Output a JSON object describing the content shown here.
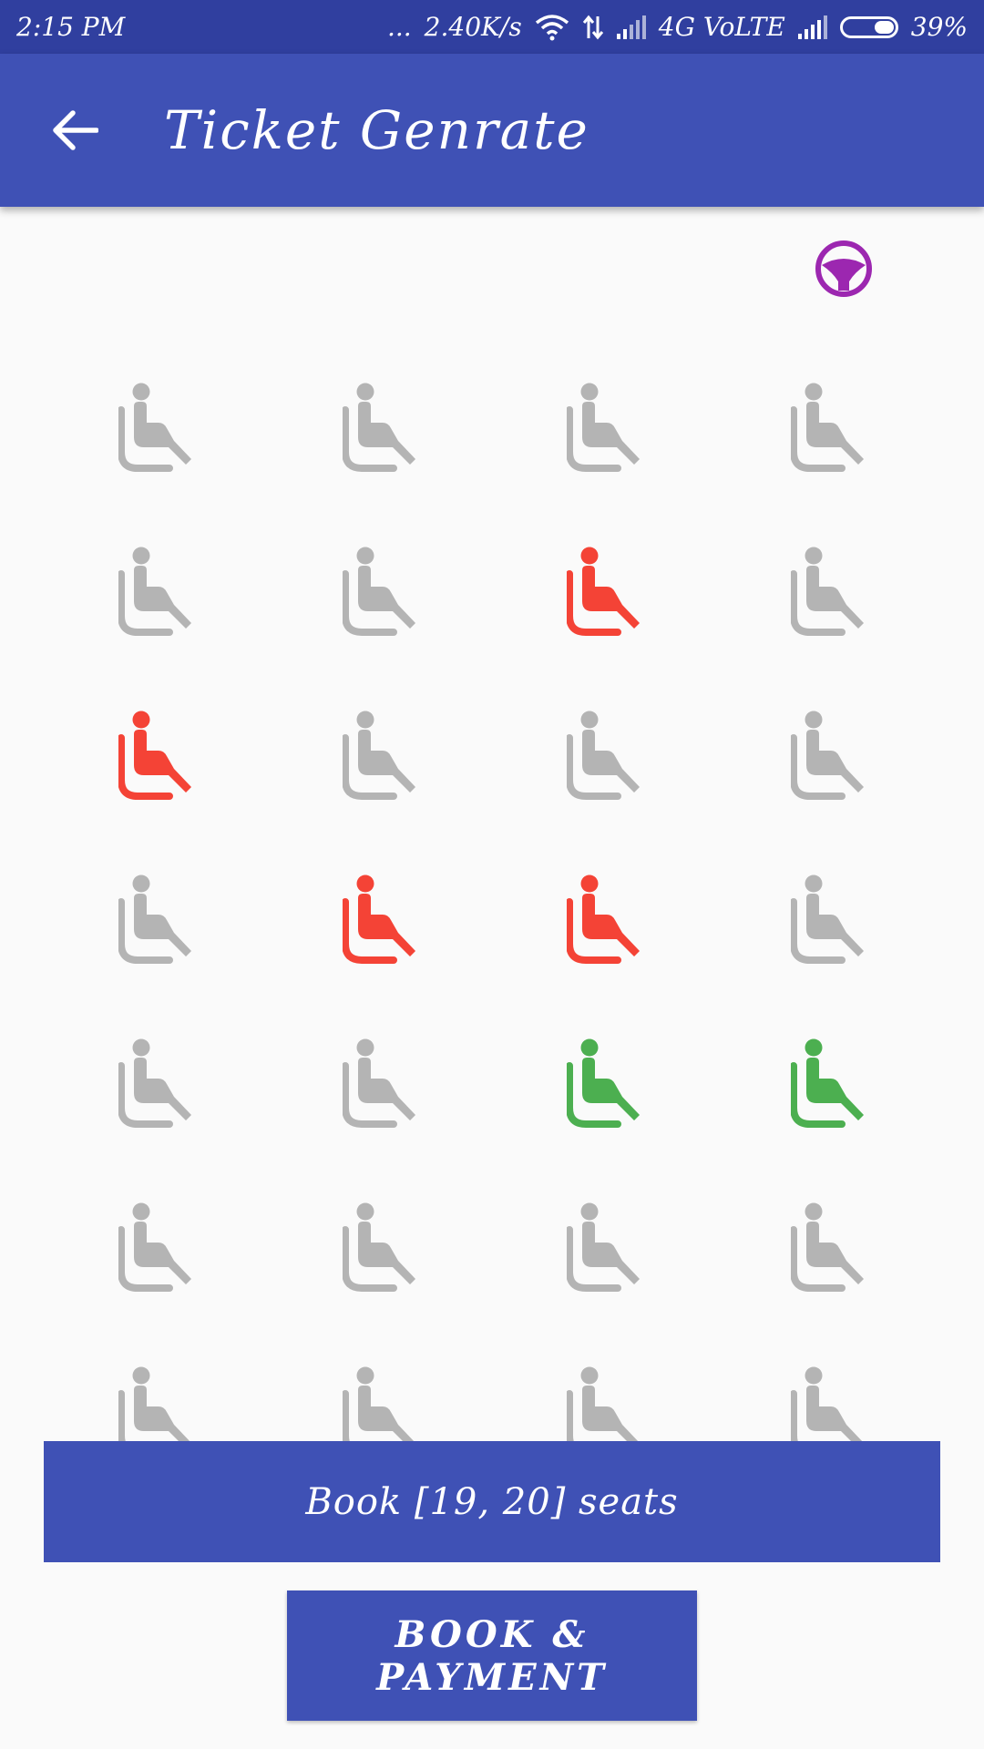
{
  "status_bar": {
    "time": "2:15 PM",
    "dots": "...",
    "speed": "2.40K/s",
    "network": "4G VoLTE",
    "battery": "39%",
    "battery_level": 0.39
  },
  "app_bar": {
    "title": "Ticket Genrate",
    "back_icon": "arrow-back-icon"
  },
  "driver": {
    "icon": "steering-wheel-icon",
    "color": "#9c27b0"
  },
  "seat_colors": {
    "available": "#b4b4b4",
    "booked": "#f44336",
    "selected": "#4caf50"
  },
  "seats": {
    "icon": "airline-seat-icon",
    "columns": 4,
    "rows": [
      [
        "available",
        "available",
        "available",
        "available"
      ],
      [
        "available",
        "available",
        "booked",
        "available"
      ],
      [
        "booked",
        "available",
        "available",
        "available"
      ],
      [
        "available",
        "booked",
        "booked",
        "available"
      ],
      [
        "available",
        "available",
        "selected",
        "selected"
      ],
      [
        "available",
        "available",
        "available",
        "available"
      ],
      [
        "available",
        "available",
        "available",
        "available"
      ]
    ]
  },
  "booking": {
    "summary": "Book [19, 20] seats",
    "button_label": "BOOK & PAYMENT"
  }
}
